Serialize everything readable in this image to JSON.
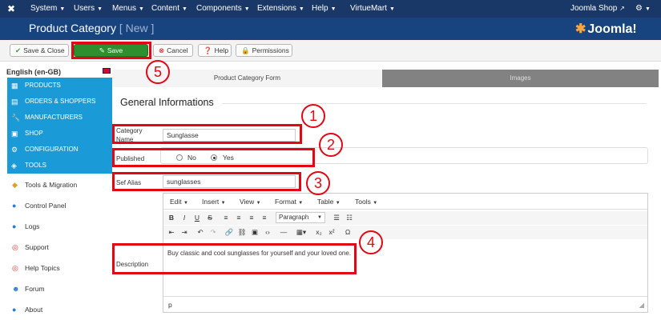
{
  "topnav": {
    "logo": "✖",
    "menus": [
      "System",
      "Users",
      "Menus",
      "Content",
      "Components",
      "Extensions",
      "Help",
      "VirtueMart"
    ],
    "site_link": "Joomla Shop",
    "settings_icon": "gear-icon"
  },
  "header": {
    "title": "Product Category",
    "title_state": "[ New ]",
    "brand": "Joomla!"
  },
  "toolbar": {
    "save_close": "Save & Close",
    "save": "Save",
    "cancel": "Cancel",
    "help": "Help",
    "permissions": "Permissions"
  },
  "sidebar": {
    "language": "English (en-GB)",
    "blue_items": [
      "PRODUCTS",
      "ORDERS & SHOPPERS",
      "MANUFACTURERS",
      "SHOP",
      "CONFIGURATION",
      "TOOLS"
    ],
    "white_items": [
      "Tools & Migration",
      "Control Panel",
      "Logs",
      "Support",
      "Help Topics",
      "Forum",
      "About"
    ]
  },
  "tabs": [
    "Product Category Form",
    "Images"
  ],
  "form": {
    "legend": "General Informations",
    "category_name_label": "Category Name",
    "category_name_value": "Sunglasse",
    "published_label": "Published",
    "published_options": [
      "No",
      "Yes"
    ],
    "published_selected": "Yes",
    "sef_alias_label": "Sef Alias",
    "sef_alias_value": "sunglasses",
    "description_label": "Description"
  },
  "editor": {
    "menus": [
      "Edit",
      "Insert",
      "View",
      "Format",
      "Table",
      "Tools"
    ],
    "paragraph_select": "Paragraph",
    "content": "Buy classic and cool sunglasses for yourself and your loved one.",
    "status_path": "p"
  },
  "annotations": [
    "1",
    "2",
    "3",
    "4",
    "5"
  ],
  "colors": {
    "nav_bg": "#1a3867",
    "header_bg": "#17447e",
    "save_green": "#2d8f2d",
    "sidebar_blue": "#1a9bd7",
    "annotation_red": "#e30613",
    "tab_inactive": "#828282"
  }
}
